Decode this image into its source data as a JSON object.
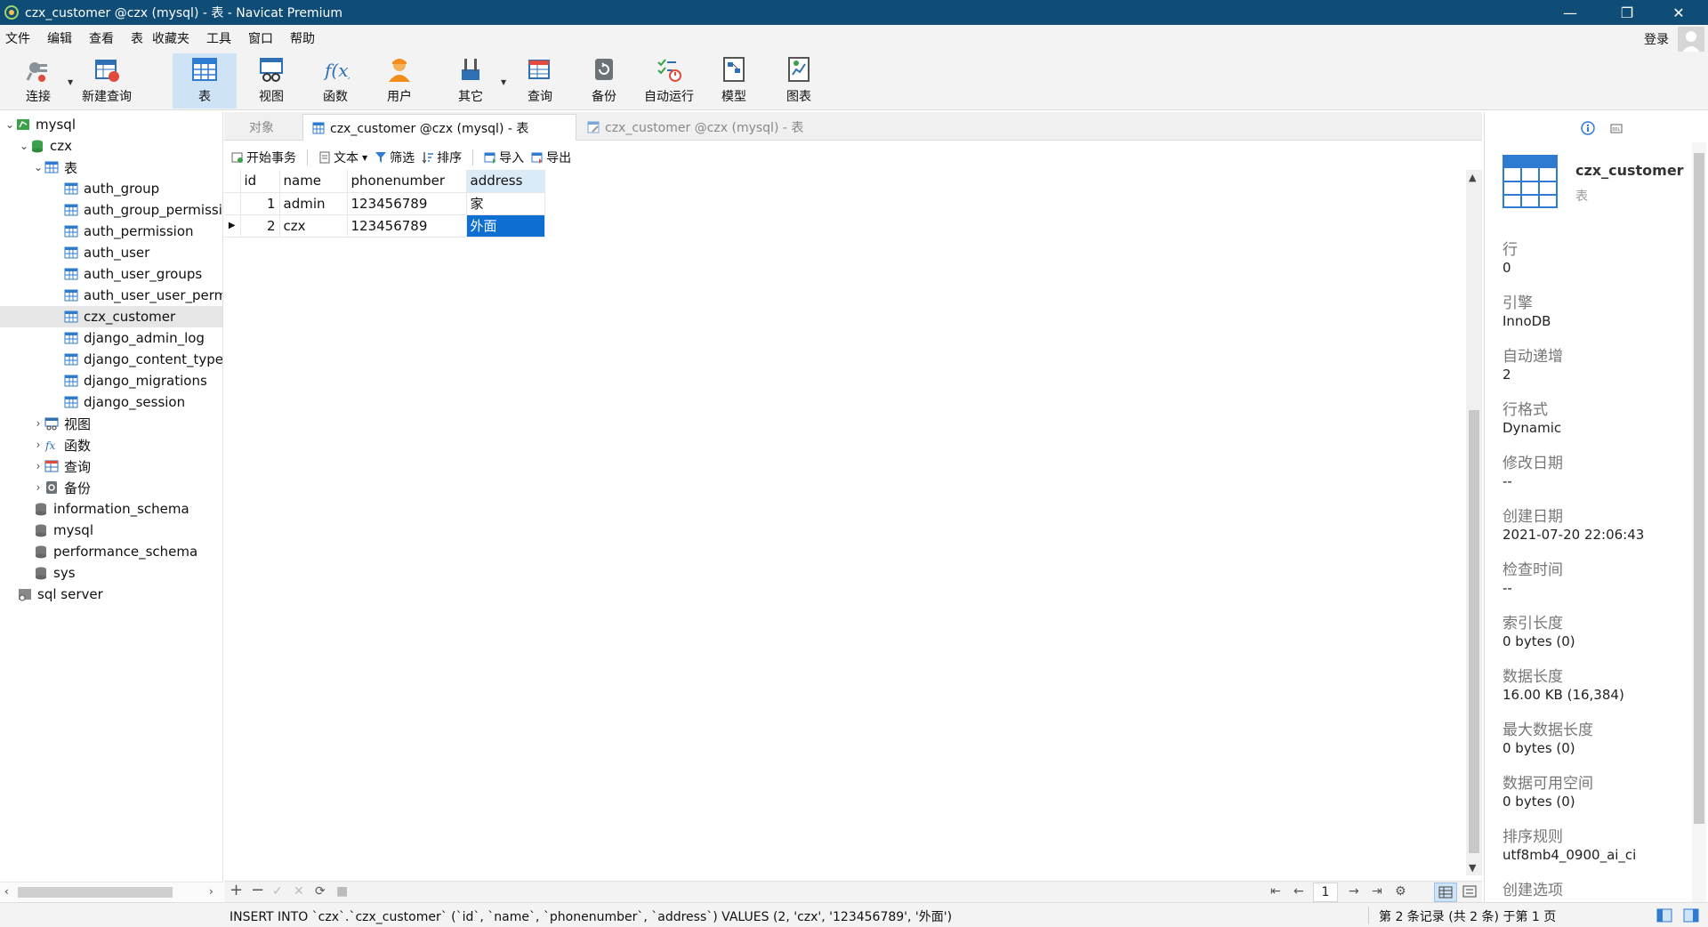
{
  "window": {
    "title": "czx_customer @czx (mysql) - 表 - Navicat Premium",
    "minimize_glyph": "—",
    "restore_glyph": "❐",
    "close_glyph": "✕"
  },
  "menubar": {
    "items": [
      "文件",
      "编辑",
      "查看",
      "表",
      "收藏夹",
      "工具",
      "窗口",
      "帮助"
    ],
    "login": "登录"
  },
  "toolbar": {
    "buttons": [
      {
        "label": "连接",
        "icon": "plug-icon"
      },
      {
        "label": "新建查询",
        "icon": "new-query-icon"
      },
      {
        "label": "表",
        "icon": "table-icon",
        "active": true
      },
      {
        "label": "视图",
        "icon": "view-icon"
      },
      {
        "label": "函数",
        "icon": "function-icon"
      },
      {
        "label": "用户",
        "icon": "user-icon"
      },
      {
        "label": "其它",
        "icon": "tools-icon"
      },
      {
        "label": "查询",
        "icon": "query-icon"
      },
      {
        "label": "备份",
        "icon": "backup-icon"
      },
      {
        "label": "自动运行",
        "icon": "auto-run-icon"
      },
      {
        "label": "模型",
        "icon": "model-icon"
      },
      {
        "label": "图表",
        "icon": "chart-icon"
      }
    ]
  },
  "tree": {
    "items": [
      {
        "label": "mysql",
        "level": 0,
        "type": "connection",
        "expanded": true
      },
      {
        "label": "czx",
        "level": 1,
        "type": "database",
        "expanded": true
      },
      {
        "label": "表",
        "level": 2,
        "type": "folder-table",
        "expanded": true
      },
      {
        "label": "auth_group",
        "level": 3,
        "type": "table"
      },
      {
        "label": "auth_group_permissions",
        "level": 3,
        "type": "table"
      },
      {
        "label": "auth_permission",
        "level": 3,
        "type": "table"
      },
      {
        "label": "auth_user",
        "level": 3,
        "type": "table"
      },
      {
        "label": "auth_user_groups",
        "level": 3,
        "type": "table"
      },
      {
        "label": "auth_user_user_permissions",
        "level": 3,
        "type": "table"
      },
      {
        "label": "czx_customer",
        "level": 3,
        "type": "table",
        "selected": true
      },
      {
        "label": "django_admin_log",
        "level": 3,
        "type": "table"
      },
      {
        "label": "django_content_type",
        "level": 3,
        "type": "table"
      },
      {
        "label": "django_migrations",
        "level": 3,
        "type": "table"
      },
      {
        "label": "django_session",
        "level": 3,
        "type": "table"
      },
      {
        "label": "视图",
        "level": 2,
        "type": "folder-view",
        "expanded": false
      },
      {
        "label": "函数",
        "level": 2,
        "type": "folder-function",
        "expanded": false
      },
      {
        "label": "查询",
        "level": 2,
        "type": "folder-query",
        "expanded": false
      },
      {
        "label": "备份",
        "level": 2,
        "type": "folder-backup",
        "expanded": false
      },
      {
        "label": "information_schema",
        "level": 1,
        "type": "database"
      },
      {
        "label": "mysql",
        "level": 1,
        "type": "database"
      },
      {
        "label": "performance_schema",
        "level": 1,
        "type": "database"
      },
      {
        "label": "sys",
        "level": 1,
        "type": "database"
      },
      {
        "label": "sql server",
        "level": 0,
        "type": "connection-sqlserver"
      }
    ]
  },
  "tabs": [
    {
      "label": "对象",
      "state": "plain"
    },
    {
      "label": "czx_customer @czx (mysql) - 表",
      "state": "active"
    },
    {
      "label": "czx_customer @czx (mysql) - 表",
      "state": "inactive"
    }
  ],
  "datatoolbar": {
    "begin_tx": "开始事务",
    "text": "文本",
    "filter": "筛选",
    "sort": "排序",
    "import": "导入",
    "export": "导出"
  },
  "grid": {
    "columns": [
      "id",
      "name",
      "phonenumber",
      "address"
    ],
    "rows": [
      {
        "id": "1",
        "name": "admin",
        "phonenumber": "123456789",
        "address": "家"
      },
      {
        "id": "2",
        "name": "czx",
        "phonenumber": "123456789",
        "address": "外面"
      }
    ],
    "current_row": 1,
    "current_col": "address",
    "row_marker": "▶"
  },
  "gridbar": {
    "add": "+",
    "delete": "−",
    "apply": "✓",
    "discard": "✕",
    "refresh": "⟳",
    "stop": "■",
    "first": "⇤",
    "prev": "←",
    "page": "1",
    "next": "→",
    "last": "⇥",
    "settings": "⚙"
  },
  "status": {
    "sql": "INSERT INTO `czx`.`czx_customer` (`id`, `name`, `phonenumber`, `address`) VALUES (2, 'czx', '123456789', '外面')",
    "records": "第 2 条记录 (共 2 条) 于第 1 页"
  },
  "info": {
    "name": "czx_customer",
    "type": "表",
    "props": [
      {
        "label": "行",
        "value": "0"
      },
      {
        "label": "引擎",
        "value": "InnoDB"
      },
      {
        "label": "自动递增",
        "value": "2"
      },
      {
        "label": "行格式",
        "value": "Dynamic"
      },
      {
        "label": "修改日期",
        "value": "--"
      },
      {
        "label": "创建日期",
        "value": "2021-07-20 22:06:43"
      },
      {
        "label": "检查时间",
        "value": "--"
      },
      {
        "label": "索引长度",
        "value": "0 bytes (0)"
      },
      {
        "label": "数据长度",
        "value": "16.00 KB (16,384)"
      },
      {
        "label": "最大数据长度",
        "value": "0 bytes (0)"
      },
      {
        "label": "数据可用空间",
        "value": "0 bytes (0)"
      },
      {
        "label": "排序规则",
        "value": "utf8mb4_0900_ai_ci"
      },
      {
        "label": "创建选项",
        "value": ""
      }
    ]
  },
  "colors": {
    "titlebar": "#0f4d77",
    "selection": "#0e6fd3",
    "active_toolbar": "#cfe3f6"
  }
}
